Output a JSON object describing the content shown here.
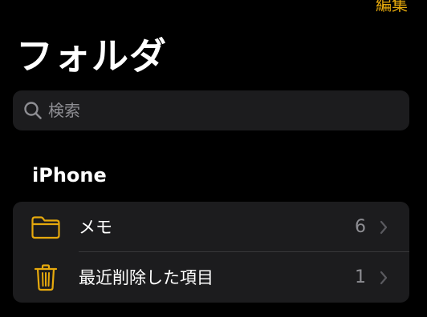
{
  "header": {
    "edit_label": "編集",
    "title": "フォルダ"
  },
  "search": {
    "placeholder": "検索",
    "value": ""
  },
  "section": {
    "title": "iPhone"
  },
  "folders": [
    {
      "label": "メモ",
      "count": "6",
      "icon": "folder-icon"
    },
    {
      "label": "最近削除した項目",
      "count": "1",
      "icon": "trash-icon"
    }
  ],
  "colors": {
    "accent": "#e6a90d",
    "background": "#000000",
    "group_background": "#1c1c1e",
    "secondary_text": "#8e8e93"
  }
}
